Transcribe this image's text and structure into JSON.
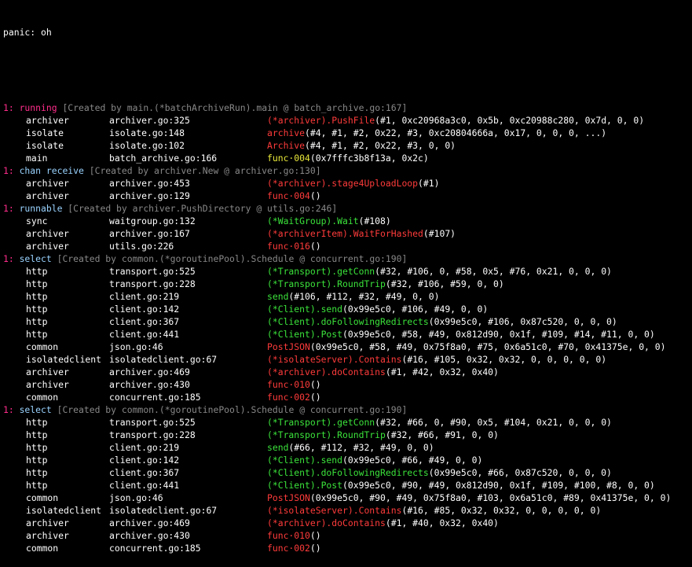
{
  "panic": "panic: oh",
  "colors": {
    "background": "#000000",
    "header_magenta": "#ff2d8b",
    "header_state": "#9ad3ff",
    "header_meta": "#888888",
    "func_red": "#ff3b3b",
    "func_green": "#3be33b",
    "func_yellow": "#e8e83b"
  },
  "groups": [
    {
      "count": "1: ",
      "state": "running",
      "meta": " [Created by main.(*batchArchiveRun).main @ batch_archive.go:167]",
      "frames": [
        {
          "pkg": "archiver",
          "src": "archiver.go:325",
          "color": "red",
          "recv": "(*archiver).",
          "func": "PushFile",
          "args": "(#1, 0xc20968a3c0, 0x5b, 0xc20988c280, 0x7d, 0, 0)"
        },
        {
          "pkg": "isolate",
          "src": "isolate.go:148",
          "color": "red",
          "recv": "",
          "func": "archive",
          "args": "(#4, #1, #2, 0x22, #3, 0xc20804666a, 0x17, 0, 0, 0, ...)"
        },
        {
          "pkg": "isolate",
          "src": "isolate.go:102",
          "color": "red",
          "recv": "",
          "func": "Archive",
          "args": "(#4, #1, #2, 0x22, #3, 0, 0)"
        },
        {
          "pkg": "main",
          "src": "batch_archive.go:166",
          "color": "yellow",
          "recv": "",
          "func": "func·004",
          "args": "(0x7fffc3b8f13a, 0x2c)"
        }
      ]
    },
    {
      "count": "1: ",
      "state": "chan receive",
      "meta": " [Created by archiver.New @ archiver.go:130]",
      "frames": [
        {
          "pkg": "archiver",
          "src": "archiver.go:453",
          "color": "red",
          "recv": "(*archiver).",
          "func": "stage4UploadLoop",
          "args": "(#1)"
        },
        {
          "pkg": "archiver",
          "src": "archiver.go:129",
          "color": "red",
          "recv": "",
          "func": "func·004",
          "args": "()"
        }
      ]
    },
    {
      "count": "1: ",
      "state": "runnable",
      "meta": " [Created by archiver.PushDirectory @ utils.go:246]",
      "frames": [
        {
          "pkg": "sync",
          "src": "waitgroup.go:132",
          "color": "green",
          "recv": "(*WaitGroup).",
          "func": "Wait",
          "args": "(#108)"
        },
        {
          "pkg": "archiver",
          "src": "archiver.go:167",
          "color": "red",
          "recv": "(*archiverItem).",
          "func": "WaitForHashed",
          "args": "(#107)"
        },
        {
          "pkg": "archiver",
          "src": "utils.go:226",
          "color": "red",
          "recv": "",
          "func": "func·016",
          "args": "()"
        }
      ]
    },
    {
      "count": "1: ",
      "state": "select",
      "meta": " [Created by common.(*goroutinePool).Schedule @ concurrent.go:190]",
      "frames": [
        {
          "pkg": "http",
          "src": "transport.go:525",
          "color": "green",
          "recv": "(*Transport).",
          "func": "getConn",
          "args": "(#32, #106, 0, #58, 0x5, #76, 0x21, 0, 0, 0)"
        },
        {
          "pkg": "http",
          "src": "transport.go:228",
          "color": "green",
          "recv": "(*Transport).",
          "func": "RoundTrip",
          "args": "(#32, #106, #59, 0, 0)"
        },
        {
          "pkg": "http",
          "src": "client.go:219",
          "color": "green",
          "recv": "",
          "func": "send",
          "args": "(#106, #112, #32, #49, 0, 0)"
        },
        {
          "pkg": "http",
          "src": "client.go:142",
          "color": "green",
          "recv": "(*Client).",
          "func": "send",
          "args": "(0x99e5c0, #106, #49, 0, 0)"
        },
        {
          "pkg": "http",
          "src": "client.go:367",
          "color": "green",
          "recv": "(*Client).",
          "func": "doFollowingRedirects",
          "args": "(0x99e5c0, #106, 0x87c520, 0, 0, 0)"
        },
        {
          "pkg": "http",
          "src": "client.go:441",
          "color": "green",
          "recv": "(*Client).",
          "func": "Post",
          "args": "(0x99e5c0, #58, #49, 0x812d90, 0x1f, #109, #14, #11, 0, 0)"
        },
        {
          "pkg": "common",
          "src": "json.go:46",
          "color": "red",
          "recv": "",
          "func": "PostJSON",
          "args": "(0x99e5c0, #58, #49, 0x75f8a0, #75, 0x6a51c0, #70, 0x41375e, 0, 0)"
        },
        {
          "pkg": "isolatedclient",
          "src": "isolatedclient.go:67",
          "color": "red",
          "recv": "(*isolateServer).",
          "func": "Contains",
          "args": "(#16, #105, 0x32, 0x32, 0, 0, 0, 0, 0)"
        },
        {
          "pkg": "archiver",
          "src": "archiver.go:469",
          "color": "red",
          "recv": "(*archiver).",
          "func": "doContains",
          "args": "(#1, #42, 0x32, 0x40)"
        },
        {
          "pkg": "archiver",
          "src": "archiver.go:430",
          "color": "red",
          "recv": "",
          "func": "func·010",
          "args": "()"
        },
        {
          "pkg": "common",
          "src": "concurrent.go:185",
          "color": "red",
          "recv": "",
          "func": "func·002",
          "args": "()"
        }
      ]
    },
    {
      "count": "1: ",
      "state": "select",
      "meta": " [Created by common.(*goroutinePool).Schedule @ concurrent.go:190]",
      "frames": [
        {
          "pkg": "http",
          "src": "transport.go:525",
          "color": "green",
          "recv": "(*Transport).",
          "func": "getConn",
          "args": "(#32, #66, 0, #90, 0x5, #104, 0x21, 0, 0, 0)"
        },
        {
          "pkg": "http",
          "src": "transport.go:228",
          "color": "green",
          "recv": "(*Transport).",
          "func": "RoundTrip",
          "args": "(#32, #66, #91, 0, 0)"
        },
        {
          "pkg": "http",
          "src": "client.go:219",
          "color": "green",
          "recv": "",
          "func": "send",
          "args": "(#66, #112, #32, #49, 0, 0)"
        },
        {
          "pkg": "http",
          "src": "client.go:142",
          "color": "green",
          "recv": "(*Client).",
          "func": "send",
          "args": "(0x99e5c0, #66, #49, 0, 0)"
        },
        {
          "pkg": "http",
          "src": "client.go:367",
          "color": "green",
          "recv": "(*Client).",
          "func": "doFollowingRedirects",
          "args": "(0x99e5c0, #66, 0x87c520, 0, 0, 0)"
        },
        {
          "pkg": "http",
          "src": "client.go:441",
          "color": "green",
          "recv": "(*Client).",
          "func": "Post",
          "args": "(0x99e5c0, #90, #49, 0x812d90, 0x1f, #109, #100, #8, 0, 0)"
        },
        {
          "pkg": "common",
          "src": "json.go:46",
          "color": "red",
          "recv": "",
          "func": "PostJSON",
          "args": "(0x99e5c0, #90, #49, 0x75f8a0, #103, 0x6a51c0, #89, 0x41375e, 0, 0)"
        },
        {
          "pkg": "isolatedclient",
          "src": "isolatedclient.go:67",
          "color": "red",
          "recv": "(*isolateServer).",
          "func": "Contains",
          "args": "(#16, #85, 0x32, 0x32, 0, 0, 0, 0, 0)"
        },
        {
          "pkg": "archiver",
          "src": "archiver.go:469",
          "color": "red",
          "recv": "(*archiver).",
          "func": "doContains",
          "args": "(#1, #40, 0x32, 0x40)"
        },
        {
          "pkg": "archiver",
          "src": "archiver.go:430",
          "color": "red",
          "recv": "",
          "func": "func·010",
          "args": "()"
        },
        {
          "pkg": "common",
          "src": "concurrent.go:185",
          "color": "red",
          "recv": "",
          "func": "func·002",
          "args": "()"
        }
      ]
    }
  ]
}
